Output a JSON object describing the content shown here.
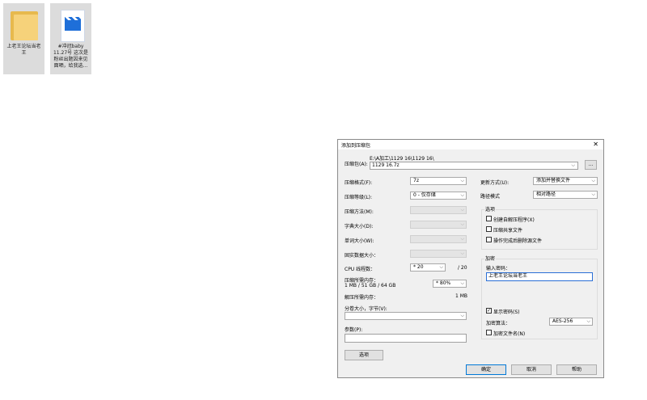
{
  "desktop": {
    "icons": [
      {
        "label": "上老王论坛当老王",
        "type": "folder-icon"
      },
      {
        "label": "#冲冠baby 11.27号 这次是粉丝出题因来见面晒，给我选...",
        "type": "video-file-icon"
      }
    ]
  },
  "dialog": {
    "title": "添加到压缩包",
    "close": "✕",
    "archive_label": "压缩包(A):",
    "archive_path": "E:\\A加工\\1129 16\\1129 16\\",
    "archive_value": "1129 16.7z",
    "browse": "...",
    "format_label": "压缩格式(F):",
    "format_value": "7z",
    "level_label": "压缩等级(L):",
    "level_value": "0 - 仅存储",
    "method_label": "压缩方法(M):",
    "dict_label": "字典大小(D):",
    "word_label": "单词大小(W):",
    "solid_label": "固实数据大小：",
    "cpu_label": "CPU 线程数：",
    "cpu_value": "* 20",
    "cpu_max": "/ 20",
    "mem_label": "压缩所需内存：",
    "mem_value": "1 MB / 51 GB / 64 GB",
    "mem_pct": "* 80%",
    "dmem_label": "解压所需内存：",
    "dmem_value": "1 MB",
    "split_label": "分卷大小，字节(V):",
    "params_label": "参数(P):",
    "options_btn": "选项",
    "update_label": "更新方式(U):",
    "update_value": "添加并替换文件",
    "path_label": "路径模式",
    "path_value": "相对路径",
    "options_group": "选项",
    "opt_sfx": "创建自解压程序(X)",
    "opt_shared": "压缩共享文件",
    "opt_delete": "操作完成后删除源文件",
    "enc_group": "加密",
    "pwd_label": "输入密码：",
    "pwd_value": "上老王论坛当老王",
    "show_pwd": "显示密码(S)",
    "show_pwd_check": "✓",
    "enc_method_label": "加密算法：",
    "enc_method_value": "AES-256",
    "enc_names": "加密文件名(N)",
    "ok": "确定",
    "cancel": "取消",
    "help": "帮助",
    "chevron": "⌵"
  }
}
